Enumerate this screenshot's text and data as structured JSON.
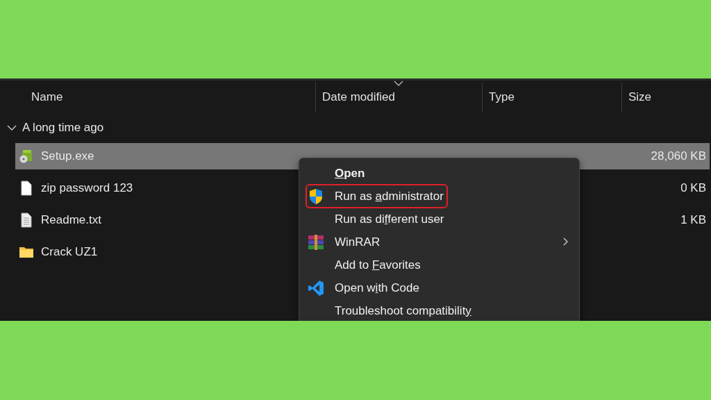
{
  "columns": [
    {
      "label": "Name",
      "sorted": false
    },
    {
      "label": "Date modified",
      "sorted": true
    },
    {
      "label": "Type",
      "sorted": false
    },
    {
      "label": "Size",
      "sorted": false
    }
  ],
  "group": {
    "label": "A long time ago",
    "expanded": true
  },
  "files": [
    {
      "kind": "setup",
      "name": "Setup.exe",
      "size": "28,060 KB",
      "selected": true
    },
    {
      "kind": "blank",
      "name": "zip password 123",
      "size": "0 KB",
      "selected": false
    },
    {
      "kind": "text",
      "name": "Readme.txt",
      "size": "1 KB",
      "selected": false
    },
    {
      "kind": "folder",
      "name": "Crack UZ1",
      "selected": false
    }
  ],
  "context_menu": {
    "items": [
      {
        "kind": "plain",
        "key": "O",
        "after": "pen",
        "default": true,
        "highlighted": false,
        "submenu": false
      },
      {
        "kind": "shield",
        "before": "Run as ",
        "key": "a",
        "after": "dministrator",
        "default": false,
        "highlighted": true,
        "submenu": false
      },
      {
        "kind": "plain",
        "before": "Run as di",
        "key": "f",
        "after": "ferent user",
        "default": false,
        "highlighted": false,
        "submenu": false
      },
      {
        "kind": "archive",
        "before": "WinRAR",
        "default": false,
        "highlighted": false,
        "submenu": true
      },
      {
        "kind": "plain",
        "before": "Add to ",
        "key": "F",
        "after": "avorites",
        "default": false,
        "highlighted": false,
        "submenu": false
      },
      {
        "kind": "editor",
        "before": "Open w",
        "key": "i",
        "after": "th Code",
        "default": false,
        "highlighted": false,
        "submenu": false
      },
      {
        "kind": "plain",
        "before": "Troubleshoot compatibilit",
        "key": "y",
        "default": false,
        "highlighted": false,
        "submenu": false
      }
    ]
  }
}
